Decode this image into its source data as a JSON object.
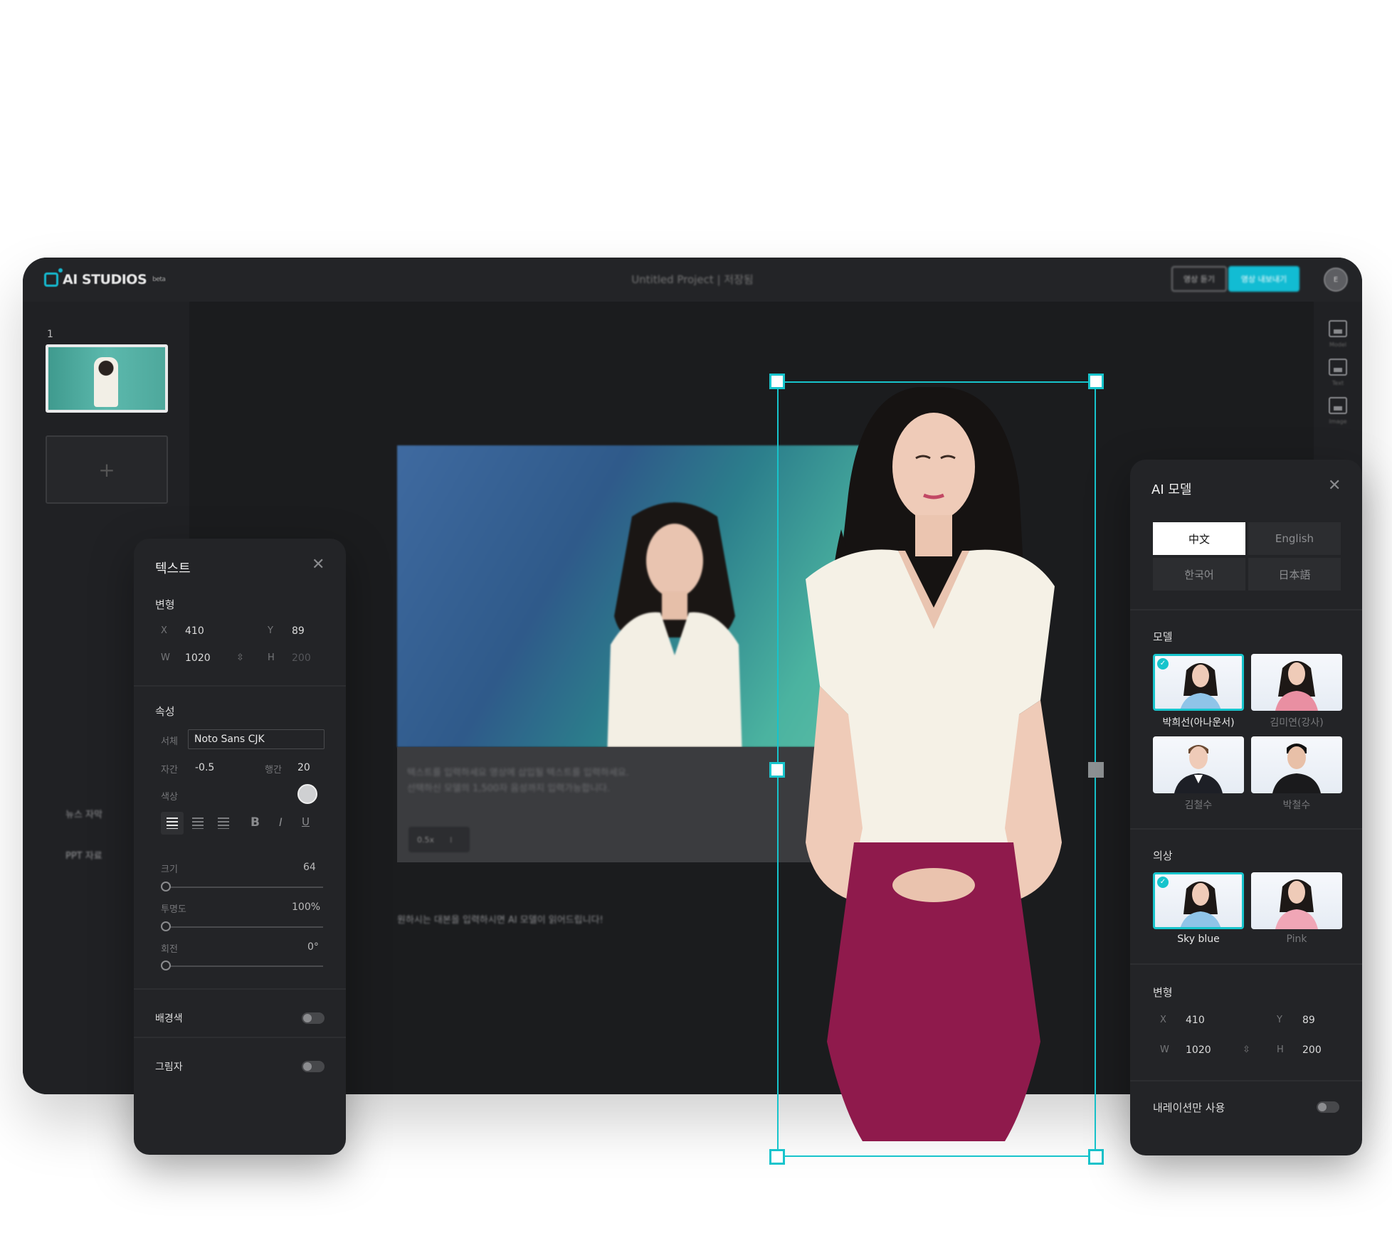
{
  "app": {
    "logo": "AI STUDIOS",
    "logo_suffix": "beta",
    "project_title": "Untitled Project | 저장됨",
    "btn_preview": "영상 듣기",
    "btn_export": "영상 내보내기",
    "user_initial": "E",
    "slide_number": "1",
    "add_slide": "+",
    "right_rail": [
      "Model",
      "Text",
      "Image"
    ],
    "bottom_items": [
      "뉴스 자막",
      "PPT 자료"
    ],
    "caption_lines": [
      "텍스트를 입력하세요 영상에 삽입될 텍스트를 입력하세요.",
      "선택하신 모델의 1,500자 음성까지 입력가능합니다."
    ],
    "caption_speed": "0.5x",
    "script_text": "원하시는 대본을 입력하시면 AI 모델이 읽어드립니다!",
    "accent_color": "#17c4cc"
  },
  "text_panel": {
    "title": "텍스트",
    "transform_title": "변형",
    "x_label": "X",
    "x_value": "410",
    "y_label": "Y",
    "y_value": "89",
    "w_label": "W",
    "w_value": "1020",
    "h_label": "H",
    "h_value": "200",
    "link_icon": "⇳",
    "props_title": "속성",
    "font_label": "서체",
    "font_value": "Noto Sans CJK",
    "spacing_label": "자간",
    "spacing_value": "-0.5",
    "line_label": "행간",
    "line_value": "20",
    "color_label": "색상",
    "size_label": "크기",
    "size_value": "64",
    "opacity_label": "투명도",
    "opacity_value": "100%",
    "rotate_label": "회전",
    "rotate_value": "0°",
    "bg_label": "배경색",
    "shadow_label": "그림자",
    "format_bold": "B",
    "format_italic": "I",
    "format_underline": "U"
  },
  "ai_panel": {
    "title": "AI 모델",
    "languages": [
      "中文",
      "English",
      "한국어",
      "日本語"
    ],
    "model_title": "모델",
    "models": [
      "박희선(아나운서)",
      "김미연(강사)",
      "김철수",
      "박철수"
    ],
    "outfit_title": "의상",
    "outfits": [
      "Sky blue",
      "Pink"
    ],
    "transform_title": "변형",
    "x_label": "X",
    "x_value": "410",
    "y_label": "Y",
    "y_value": "89",
    "w_label": "W",
    "w_value": "1020",
    "h_label": "H",
    "h_value": "200",
    "link_icon": "⇳",
    "narration_label": "내레이션만 사용"
  }
}
